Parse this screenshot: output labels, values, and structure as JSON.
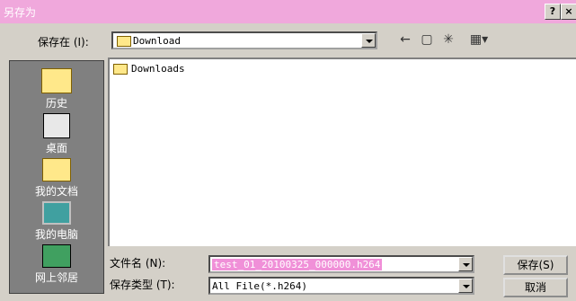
{
  "window": {
    "title": "另存为",
    "help_label": "?",
    "close_label": "×"
  },
  "save_in": {
    "label": "保存在 (I):",
    "value": "Download"
  },
  "toolbar": {
    "back_icon": "back-arrow-icon",
    "up_icon": "up-folder-icon",
    "new_folder_icon": "new-folder-icon",
    "view_icon": "view-menu-icon"
  },
  "places": [
    {
      "label": "历史",
      "icon": "history-folder-icon"
    },
    {
      "label": "桌面",
      "icon": "desktop-icon"
    },
    {
      "label": "我的文档",
      "icon": "my-documents-icon"
    },
    {
      "label": "我的电脑",
      "icon": "my-computer-icon"
    },
    {
      "label": "网上邻居",
      "icon": "network-icon"
    }
  ],
  "files": [
    {
      "name": "Downloads",
      "icon": "folder-icon"
    }
  ],
  "filename": {
    "label": "文件名 (N):",
    "value": "test_01_20100325_000000.h264"
  },
  "filetype": {
    "label": "保存类型 (T):",
    "value": "All File(*.h264)"
  },
  "buttons": {
    "save": "保存(S)",
    "cancel": "取消"
  }
}
